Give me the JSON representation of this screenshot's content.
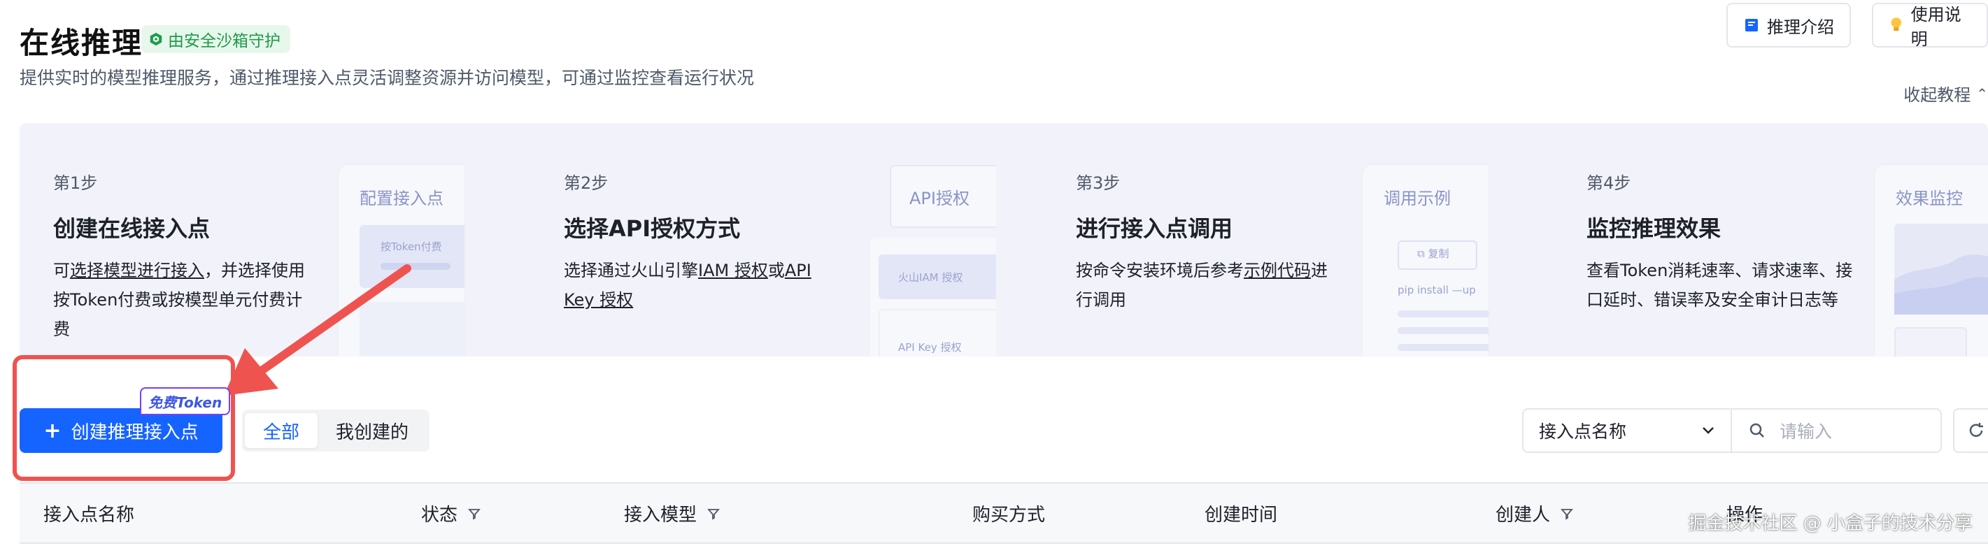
{
  "header": {
    "title": "在线推理",
    "sandbox_badge": "由安全沙箱守护",
    "subtitle": "提供实时的模型推理服务，通过推理接入点灵活调整资源并访问模型，可通过监控查看运行状况",
    "intro_button": "推理介绍",
    "guide_button": "使用说明",
    "collapse_label": "收起教程"
  },
  "steps": [
    {
      "no": "第1步",
      "title": "创建在线接入点",
      "desc_pre": "可",
      "desc_link": "选择模型进行接入",
      "desc_post": "，并选择使用按Token付费或按模型单元付费计费",
      "preview_label": "配置接入点",
      "preview_item": "按Token付费"
    },
    {
      "no": "第2步",
      "title": "选择API授权方式",
      "desc_pre": "选择通过火山引擎",
      "desc_link": "IAM 授权",
      "desc_mid": "或",
      "desc_link2": "API Key 授权",
      "preview_label": "API授权",
      "preview_item": "火山IAM 授权",
      "preview_item2": "API Key 授权"
    },
    {
      "no": "第3步",
      "title": "进行接入点调用",
      "desc_pre": "按命令安装环境后参考",
      "desc_link": "示例代码",
      "desc_post": "进行调用",
      "preview_label": "调用示例",
      "preview_item": "复制",
      "preview_item2": "pip install —up"
    },
    {
      "no": "第4步",
      "title": "监控推理效果",
      "desc": "查看Token消耗速率、请求速率、接口延时、错误率及安全审计日志等",
      "preview_label": "效果监控"
    }
  ],
  "toolbar": {
    "create_button": "创建推理接入点",
    "free_badge": "免费Token",
    "tabs": [
      "全部",
      "我创建的"
    ],
    "filter_select": "接入点名称",
    "search_placeholder": "请输入"
  },
  "table": {
    "columns": [
      "接入点名称",
      "状态",
      "接入模型",
      "购买方式",
      "创建时间",
      "创建人",
      "操作"
    ]
  },
  "watermark": "掘金技术社区 @ 小盒子的技术分享",
  "colors": {
    "primary": "#1664ff",
    "highlight_red": "#ef5350",
    "badge_green": "#1e9b4a",
    "panel_bg": "#f2f3fa"
  }
}
